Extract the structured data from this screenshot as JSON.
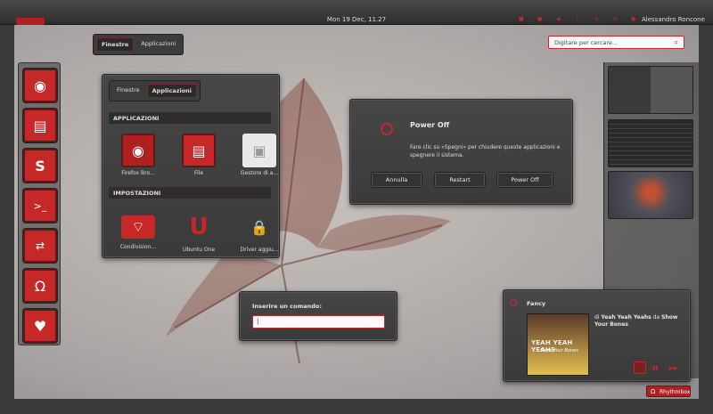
{
  "topbar": {
    "clock": "Mon 19 Dec, 11.27",
    "user": "Alessandro Roncone"
  },
  "overview_tabs": [
    "Finestre",
    "Applicazioni"
  ],
  "search": {
    "placeholder": "Digitare per cercare..."
  },
  "dock": {
    "items": [
      "firefox-icon",
      "files-icon",
      "skype-icon",
      "terminal-icon",
      "remote-desktop-icon",
      "headphones-icon",
      "twitter-icon"
    ]
  },
  "apps_panel": {
    "tabs": [
      "Finestre",
      "Applicazioni"
    ],
    "applications_header": "APPLICAZIONI",
    "applications": [
      "Firefox Bro...",
      "File",
      "Gestore di a..."
    ],
    "settings_header": "IMPOSTAZIONI",
    "settings": [
      "Condivision...",
      "Ubuntu One",
      "Driver aggiu..."
    ]
  },
  "power_dialog": {
    "title": "Power Off",
    "message": "Fare clic su «Spegni» per chiudere queste applicazioni e spegnere il sistema.",
    "buttons": [
      "Annulla",
      "Restart",
      "Power Off"
    ]
  },
  "run_dialog": {
    "label": "Inserire un comando:"
  },
  "music": {
    "title": "Fancy",
    "by_prefix": "di",
    "artist": "Yeah Yeah Yeahs",
    "from_prefix": "da",
    "album": "Show Your Bones",
    "cover_title": "YEAH YEAH YEAHS",
    "cover_subtitle": "Show Your Bones"
  },
  "taskbar": {
    "app": "Rhythmbox"
  },
  "colors": {
    "accent": "#c62828",
    "panel": "#3f3f3f"
  }
}
